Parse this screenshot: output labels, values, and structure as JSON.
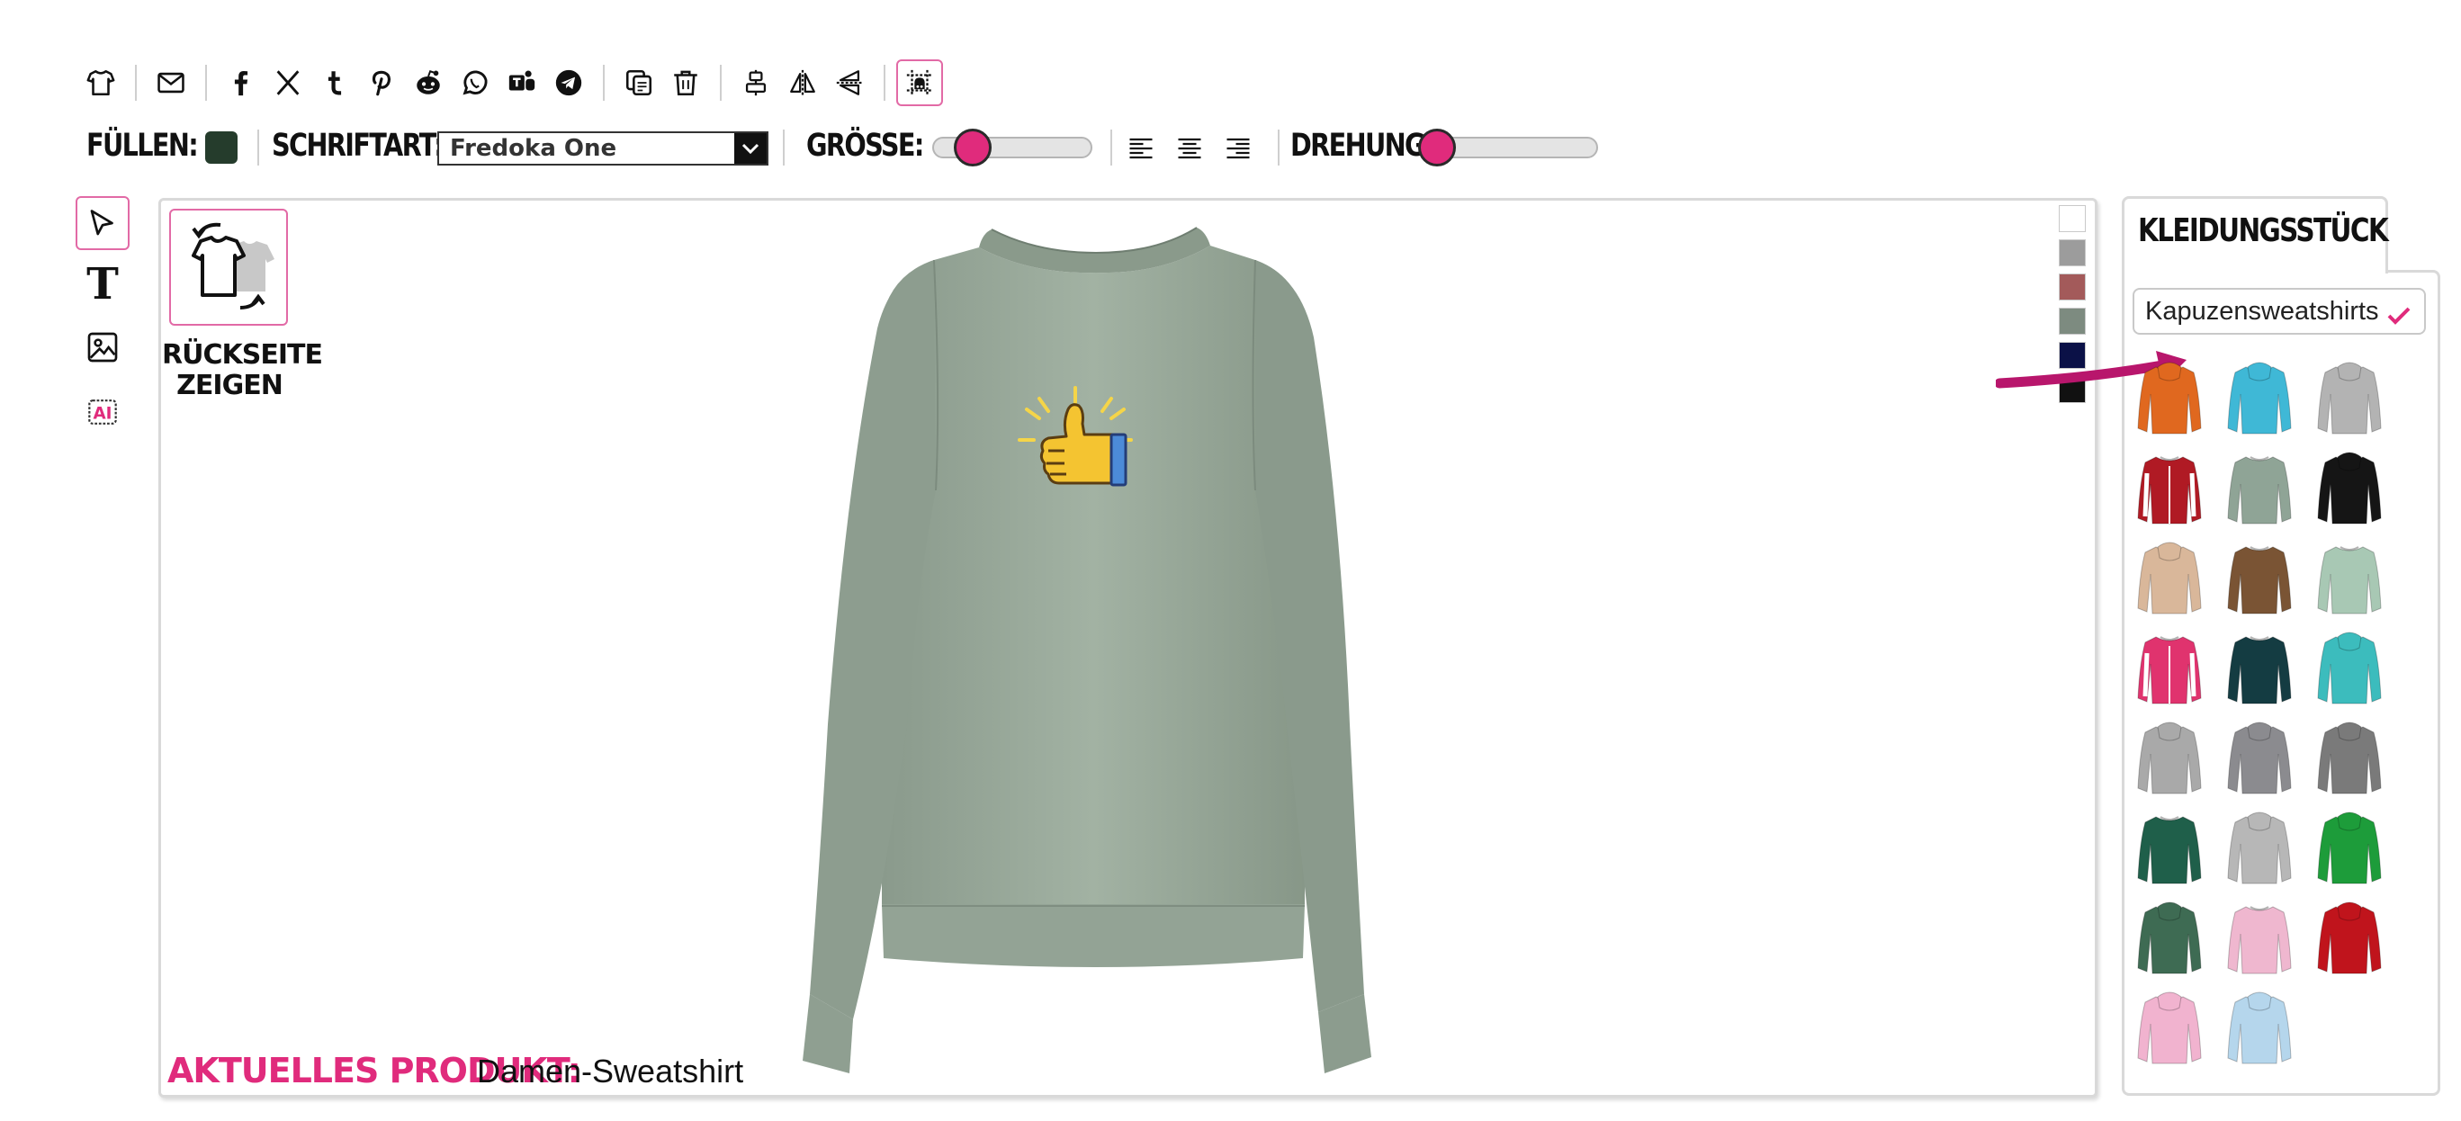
{
  "toolbar": {
    "buttons": [
      "tshirt-icon",
      "mail-icon",
      "facebook-icon",
      "x-icon",
      "tumblr-icon",
      "pinterest-icon",
      "reddit-icon",
      "whatsapp-icon",
      "teams-icon",
      "telegram-icon",
      "duplicate-icon",
      "trash-icon",
      "align-center-vertical-icon",
      "flip-horizontal-icon",
      "flip-vertical-icon",
      "grid-icon"
    ]
  },
  "options": {
    "fill_label": "FÜLLEN:",
    "fill_color": "#253c2c",
    "font_label": "SCHRIFTART:",
    "font_value": "Fredoka One",
    "size_label": "GRÖSSE:",
    "size_value": 0.2,
    "rotation_label": "DREHUNG:",
    "rotation_value": 0.0
  },
  "left_tools": [
    "pointer-icon",
    "text-icon",
    "image-icon",
    "ai-icon"
  ],
  "left_tools_text": {
    "text_tool": "T",
    "ai_tool": "AI"
  },
  "canvas": {
    "back_button_label": "RÜCKSEITE ZEIGEN",
    "product_label": "AKTUELLES PRODUKT:",
    "product_name": "Damen-Sweatshirt",
    "garment_color": "#9aaa9b",
    "colors": [
      "#ffffff",
      "#9c9c9c",
      "#a35a5a",
      "#7d8b80",
      "#0b1147",
      "#111111"
    ]
  },
  "panel": {
    "tab_label": "KLEIDUNGSSTÜCK",
    "category_value": "Kapuzensweatshirts",
    "garments": [
      {
        "name": "garment-orange-hoodie",
        "color": "#e0681f",
        "type": "hoodie"
      },
      {
        "name": "garment-turquoise-hoodie",
        "color": "#3fb8d6",
        "type": "hoodie"
      },
      {
        "name": "garment-grey-hoodie",
        "color": "#b3b3b3",
        "type": "hoodie"
      },
      {
        "name": "garment-red-college-jacket",
        "color": "#b01a24",
        "type": "jacket"
      },
      {
        "name": "garment-sage-sweatshirt",
        "color": "#8fa496",
        "type": "sweater"
      },
      {
        "name": "garment-black-orange-hoodie",
        "color": "#151515",
        "type": "hoodie"
      },
      {
        "name": "garment-ombre-hoodie",
        "color": "#d9b79a",
        "type": "hoodie"
      },
      {
        "name": "garment-brown-sweatshirt",
        "color": "#7a5434",
        "type": "sweater"
      },
      {
        "name": "garment-mint-sweatshirt",
        "color": "#a8c8b4",
        "type": "sweater"
      },
      {
        "name": "garment-pink-college-jacket",
        "color": "#e0336e",
        "type": "jacket"
      },
      {
        "name": "garment-teal-dark-sweatshirt",
        "color": "#143c42",
        "type": "sweater"
      },
      {
        "name": "garment-turquoise-zip-hoodie",
        "color": "#3cbcbd",
        "type": "hoodie"
      },
      {
        "name": "garment-light-grey-sleeveless-hoodie",
        "color": "#a9a9a9",
        "type": "hoodie"
      },
      {
        "name": "garment-grey-zip-hoodie",
        "color": "#8b8b8f",
        "type": "hoodie"
      },
      {
        "name": "garment-dark-grey-hoodie",
        "color": "#7a7a7a",
        "type": "hoodie"
      },
      {
        "name": "garment-bottle-green-sweatshirt",
        "color": "#1f5f4a",
        "type": "sweater"
      },
      {
        "name": "garment-grey-women-hoodie",
        "color": "#b7b7b7",
        "type": "hoodie"
      },
      {
        "name": "garment-green-hoodie",
        "color": "#1d9c3a",
        "type": "hoodie"
      },
      {
        "name": "garment-green-zip-hoodie",
        "color": "#3e6b53",
        "type": "hoodie"
      },
      {
        "name": "garment-pink-sweatshirt",
        "color": "#efb7cf",
        "type": "sweater"
      },
      {
        "name": "garment-red-hoodie",
        "color": "#c0141c",
        "type": "hoodie"
      },
      {
        "name": "garment-light-pink-hoodie",
        "color": "#f1b3cf",
        "type": "hoodie"
      },
      {
        "name": "garment-light-blue-hoodie",
        "color": "#b5d6ec",
        "type": "hoodie"
      }
    ]
  },
  "accent_color": "#e02b7c"
}
